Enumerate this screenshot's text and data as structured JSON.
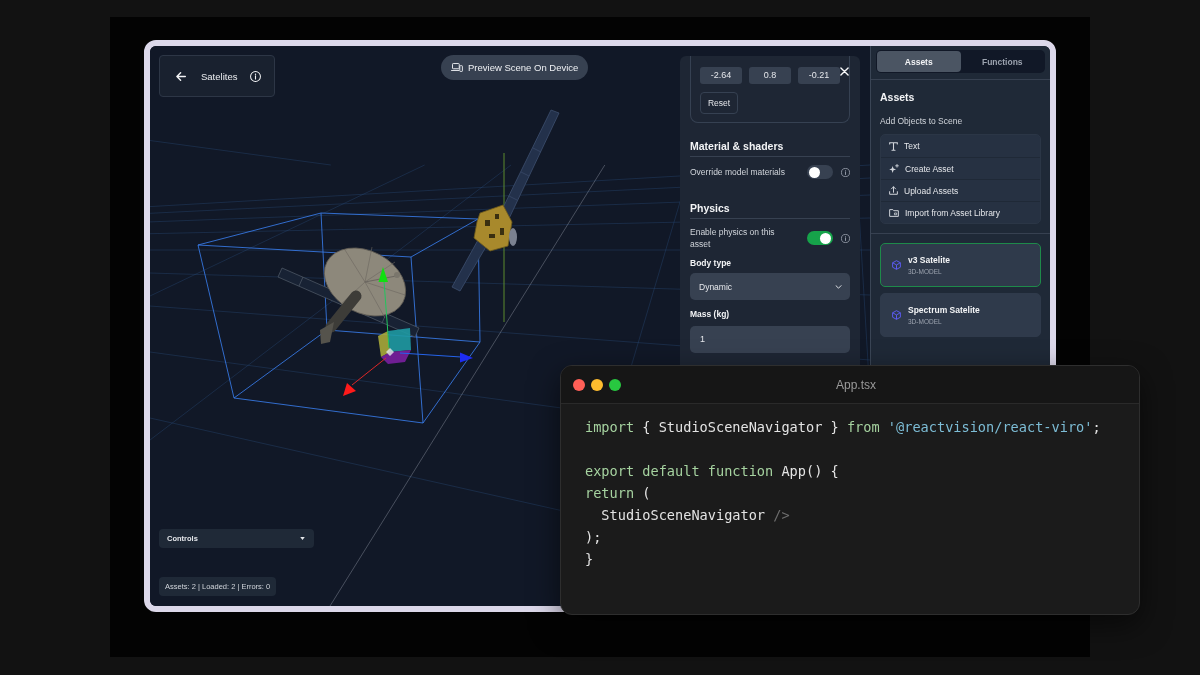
{
  "scene_header": {
    "title": "Satelites"
  },
  "preview_button": {
    "label": "Preview Scene On Device"
  },
  "properties_panel": {
    "vector_fields": [
      "-2.64",
      "0.8",
      "-0.21"
    ],
    "reset_button": "Reset",
    "sections": [
      {
        "title": "Material & shaders",
        "rows": [
          {
            "kind": "toggle",
            "label": "Override model materials",
            "on": false
          }
        ]
      },
      {
        "title": "Physics",
        "rows": [
          {
            "kind": "toggle",
            "label": "Enable physics on this asset",
            "on": true
          },
          {
            "kind": "select",
            "label": "Body type",
            "value": "Dynamic"
          },
          {
            "kind": "input",
            "label": "Mass (kg)",
            "value": "1"
          }
        ]
      }
    ]
  },
  "sidebar": {
    "tabs": [
      {
        "label": "Assets",
        "selected": true
      },
      {
        "label": "Functions",
        "selected": false
      }
    ],
    "heading": "Assets",
    "subheading": "Add Objects to Scene",
    "actions": [
      {
        "kind": "text",
        "label": "Text"
      },
      {
        "kind": "create",
        "label": "Create Asset"
      },
      {
        "kind": "upload",
        "label": "Upload Assets"
      },
      {
        "kind": "import",
        "label": "Import from Asset Library"
      }
    ],
    "assets": [
      {
        "name": "v3 Satelite",
        "type": "3D-MODEL",
        "selected": true
      },
      {
        "name": "Spectrum Satelite",
        "type": "3D-MODEL",
        "selected": false
      }
    ]
  },
  "controls_dropdown": {
    "label": "Controls"
  },
  "status_bar": {
    "text": "Assets: 2 | Loaded: 2 | Errors: 0"
  },
  "code_window": {
    "title": "App.tsx",
    "blocks": [
      {
        "lines": [
          {
            "tokens": [
              {
                "kind": "keyword",
                "text": "import"
              },
              {
                "kind": "plain",
                "text": " { StudioSceneNavigator } "
              },
              {
                "kind": "keyword",
                "text": "from"
              },
              {
                "kind": "string",
                "text": " '@reactvision/react-viro'"
              },
              {
                "kind": "plain",
                "text": ";"
              }
            ]
          }
        ]
      },
      {
        "lines": [
          {
            "tokens": [
              {
                "kind": "keyword",
                "text": "export default function"
              },
              {
                "kind": "plain",
                "text": " App() {"
              }
            ]
          },
          {
            "tokens": [
              {
                "kind": "keyword",
                "text": "return"
              },
              {
                "kind": "plain",
                "text": " ("
              }
            ]
          },
          {
            "tokens": [
              {
                "kind": "plain",
                "text": "  StudioSceneNavigator "
              },
              {
                "kind": "muted",
                "text": "/>"
              }
            ]
          },
          {
            "tokens": [
              {
                "kind": "plain",
                "text": ");"
              }
            ]
          },
          {
            "tokens": [
              {
                "kind": "plain",
                "text": "}"
              }
            ]
          }
        ]
      }
    ]
  }
}
